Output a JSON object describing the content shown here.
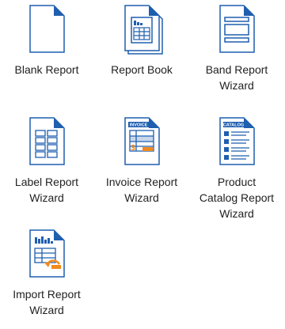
{
  "accent_color": "#1F5FAF",
  "highlight_color": "#F08A1E",
  "tiles": [
    {
      "label": "Blank Report",
      "icon": "blank-report-icon"
    },
    {
      "label": "Report Book",
      "icon": "report-book-icon"
    },
    {
      "label": "Band Report\nWizard",
      "icon": "band-report-wizard-icon"
    },
    {
      "label": "Label Report\nWizard",
      "icon": "label-report-wizard-icon"
    },
    {
      "label": "Invoice Report\nWizard",
      "icon": "invoice-report-wizard-icon",
      "badge": "INVOICE"
    },
    {
      "label": "Product\nCatalog Report\nWizard",
      "icon": "product-catalog-report-wizard-icon",
      "badge": "CATALOG"
    },
    {
      "label": "Import Report\nWizard",
      "icon": "import-report-wizard-icon"
    }
  ]
}
